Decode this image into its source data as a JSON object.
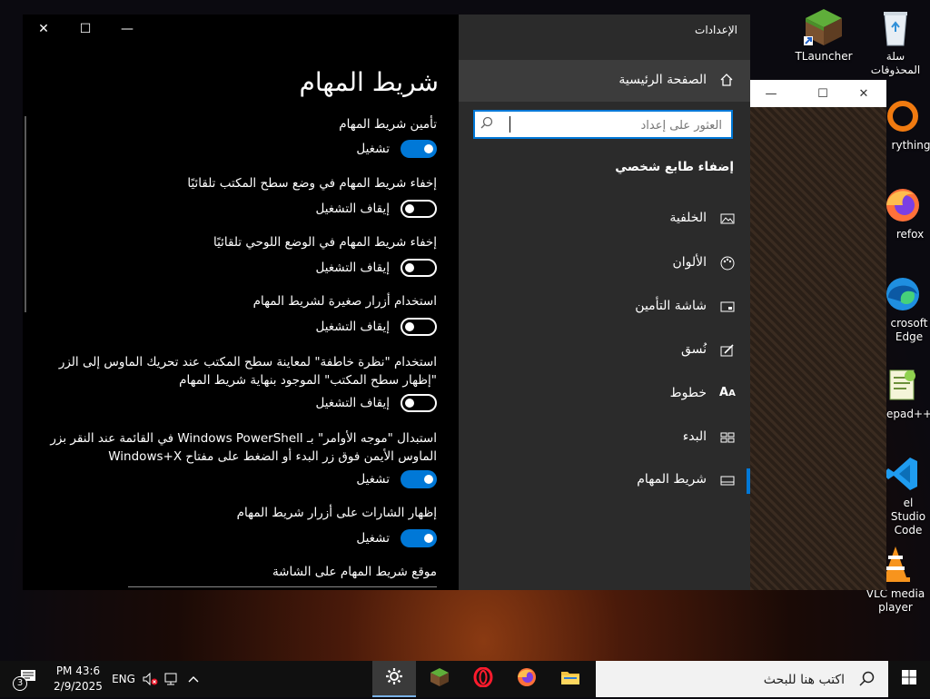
{
  "desktop": {
    "icons": [
      {
        "label": "TLauncher"
      },
      {
        "label": "سلة المحذوفات"
      },
      {
        "label": "rything"
      },
      {
        "label": "refox"
      },
      {
        "label": "crosoft Edge"
      },
      {
        "label": "epad++"
      },
      {
        "label": "el Studio Code"
      },
      {
        "label": "VLC media player"
      }
    ]
  },
  "bg_window": {
    "minimize": "—",
    "maximize": "☐",
    "close": "✕"
  },
  "settings": {
    "app_title": "الإعدادات",
    "caption": {
      "minimize": "—",
      "maximize": "☐",
      "close": "✕"
    },
    "home_label": "الصفحة الرئيسية",
    "search": {
      "placeholder": "العثور على إعداد",
      "value": ""
    },
    "section_heading": "إضفاء طابع شخصي",
    "nav_items": [
      {
        "label": "الخلفية",
        "icon": "image-icon"
      },
      {
        "label": "الألوان",
        "icon": "palette-icon"
      },
      {
        "label": "شاشة التأمين",
        "icon": "lock-screen-icon"
      },
      {
        "label": "نُسق",
        "icon": "themes-icon"
      },
      {
        "label": "خطوط",
        "icon": "fonts-icon"
      },
      {
        "label": "البدء",
        "icon": "start-icon"
      },
      {
        "label": "شريط المهام",
        "icon": "taskbar-icon",
        "selected": true
      }
    ],
    "page_title": "شريط المهام",
    "options": [
      {
        "label": "تأمين شريط المهام",
        "state": "تشغيل",
        "on": true
      },
      {
        "label": "إخفاء شريط المهام في وضع سطح المكتب تلقائيًا",
        "state": "إيقاف التشغيل",
        "on": false
      },
      {
        "label": "إخفاء شريط المهام في الوضع اللوحي تلقائيًا",
        "state": "إيقاف التشغيل",
        "on": false
      },
      {
        "label": "استخدام أزرار صغيرة لشريط المهام",
        "state": "إيقاف التشغيل",
        "on": false
      },
      {
        "label": "استخدام \"نظرة خاطفة\" لمعاينة سطح المكتب عند تحريك الماوس إلى الزر \"إظهار سطح المكتب\" الموجود بنهاية شريط المهام",
        "state": "إيقاف التشغيل",
        "on": false
      },
      {
        "label": "استبدال \"موجه الأوامر\" بـ Windows PowerShell في القائمة عند النقر بزر الماوس الأيمن فوق زر البدء أو الضغط على مفتاح Windows+X",
        "state": "تشغيل",
        "on": true
      },
      {
        "label": "إظهار الشارات على أزرار شريط المهام",
        "state": "تشغيل",
        "on": true
      }
    ],
    "next_section_label": "موقع شريط المهام على الشاشة"
  },
  "taskbar": {
    "search_placeholder": "اكتب هنا للبحث",
    "clock_time": "PM 43:6",
    "clock_date": "2/9/2025",
    "language": "ENG",
    "notification_count": "3"
  },
  "colors": {
    "accent": "#0078d7",
    "pane_dark": "#2b2b2b",
    "selected_home": "#3c3c3c"
  }
}
